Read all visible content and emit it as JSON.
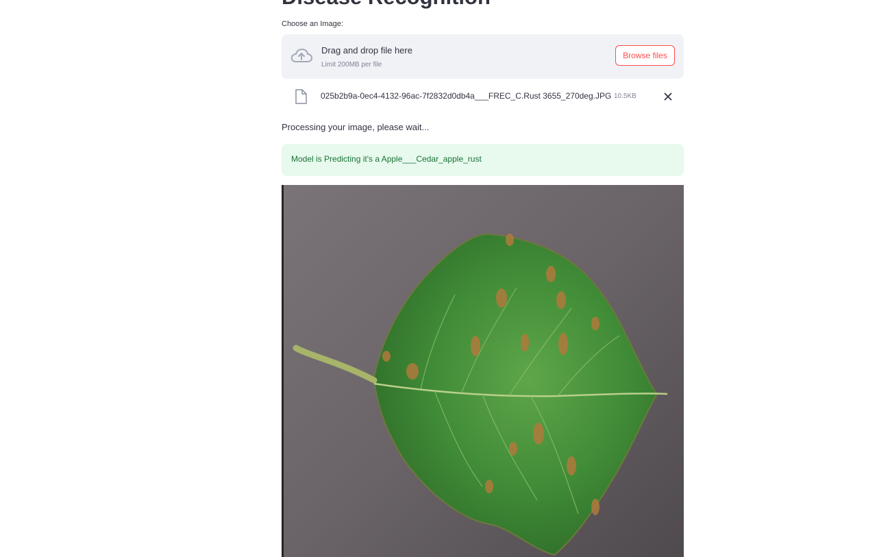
{
  "page": {
    "title": "Disease Recognition"
  },
  "uploader": {
    "label": "Choose an Image:",
    "dropzone_title": "Drag and drop file here",
    "dropzone_limit": "Limit 200MB per file",
    "browse_label": "Browse files",
    "icon": "cloud-upload-icon"
  },
  "file": {
    "name": "025b2b9a-0ec4-4132-96ac-7f2832d0db4a___FREC_C.Rust 3655_270deg.JPG",
    "size": "10.5KB",
    "icon": "file-icon",
    "remove_icon": "close-icon"
  },
  "status": {
    "processing": "Processing your image, please wait..."
  },
  "result": {
    "message": "Model is Predicting it's a Apple___Cedar_apple_rust"
  },
  "colors": {
    "accent": "#ff4b4b",
    "success_bg": "#e8f9ee",
    "success_text": "#177233",
    "dropzone_bg": "#f0f2f6"
  }
}
